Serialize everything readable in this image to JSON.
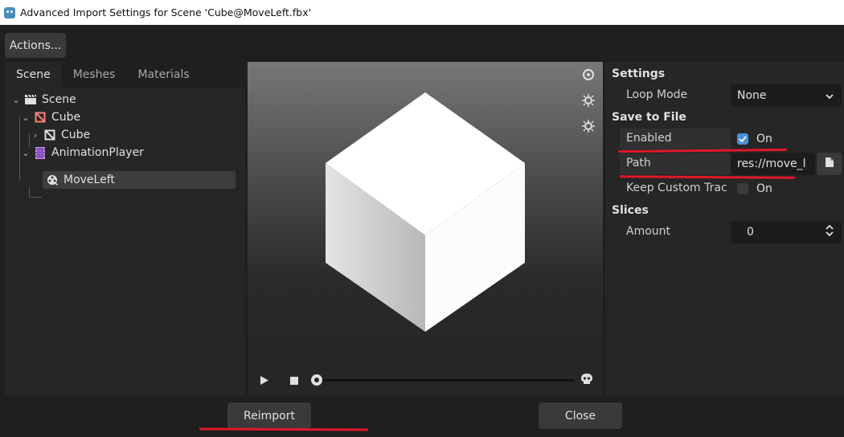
{
  "window": {
    "title": "Advanced Import Settings for Scene 'Cube@MoveLeft.fbx'"
  },
  "toolbar": {
    "actions_label": "Actions..."
  },
  "tabs": [
    {
      "label": "Scene",
      "active": true
    },
    {
      "label": "Meshes",
      "active": false
    },
    {
      "label": "Materials",
      "active": false
    }
  ],
  "tree": {
    "scene": "Scene",
    "cube_node": "Cube",
    "cube_mesh": "Cube",
    "animation_player": "AnimationPlayer",
    "move_left": "MoveLeft"
  },
  "settings": {
    "header": "Settings",
    "loop_mode_label": "Loop Mode",
    "loop_mode_value": "None",
    "save_header": "Save to File",
    "enabled_label": "Enabled",
    "enabled_value": "On",
    "path_label": "Path",
    "path_value": "res://move_l",
    "keep_label": "Keep Custom Trac",
    "keep_value": "On",
    "slices_header": "Slices",
    "amount_label": "Amount",
    "amount_value": "0"
  },
  "footer": {
    "reimport_label": "Reimport",
    "close_label": "Close"
  },
  "colors": {
    "accent": "#4a90d9",
    "annotation_red": "#e0182a",
    "node3d_red": "#fc7f7f",
    "animation_purple": "#c38ef1"
  }
}
